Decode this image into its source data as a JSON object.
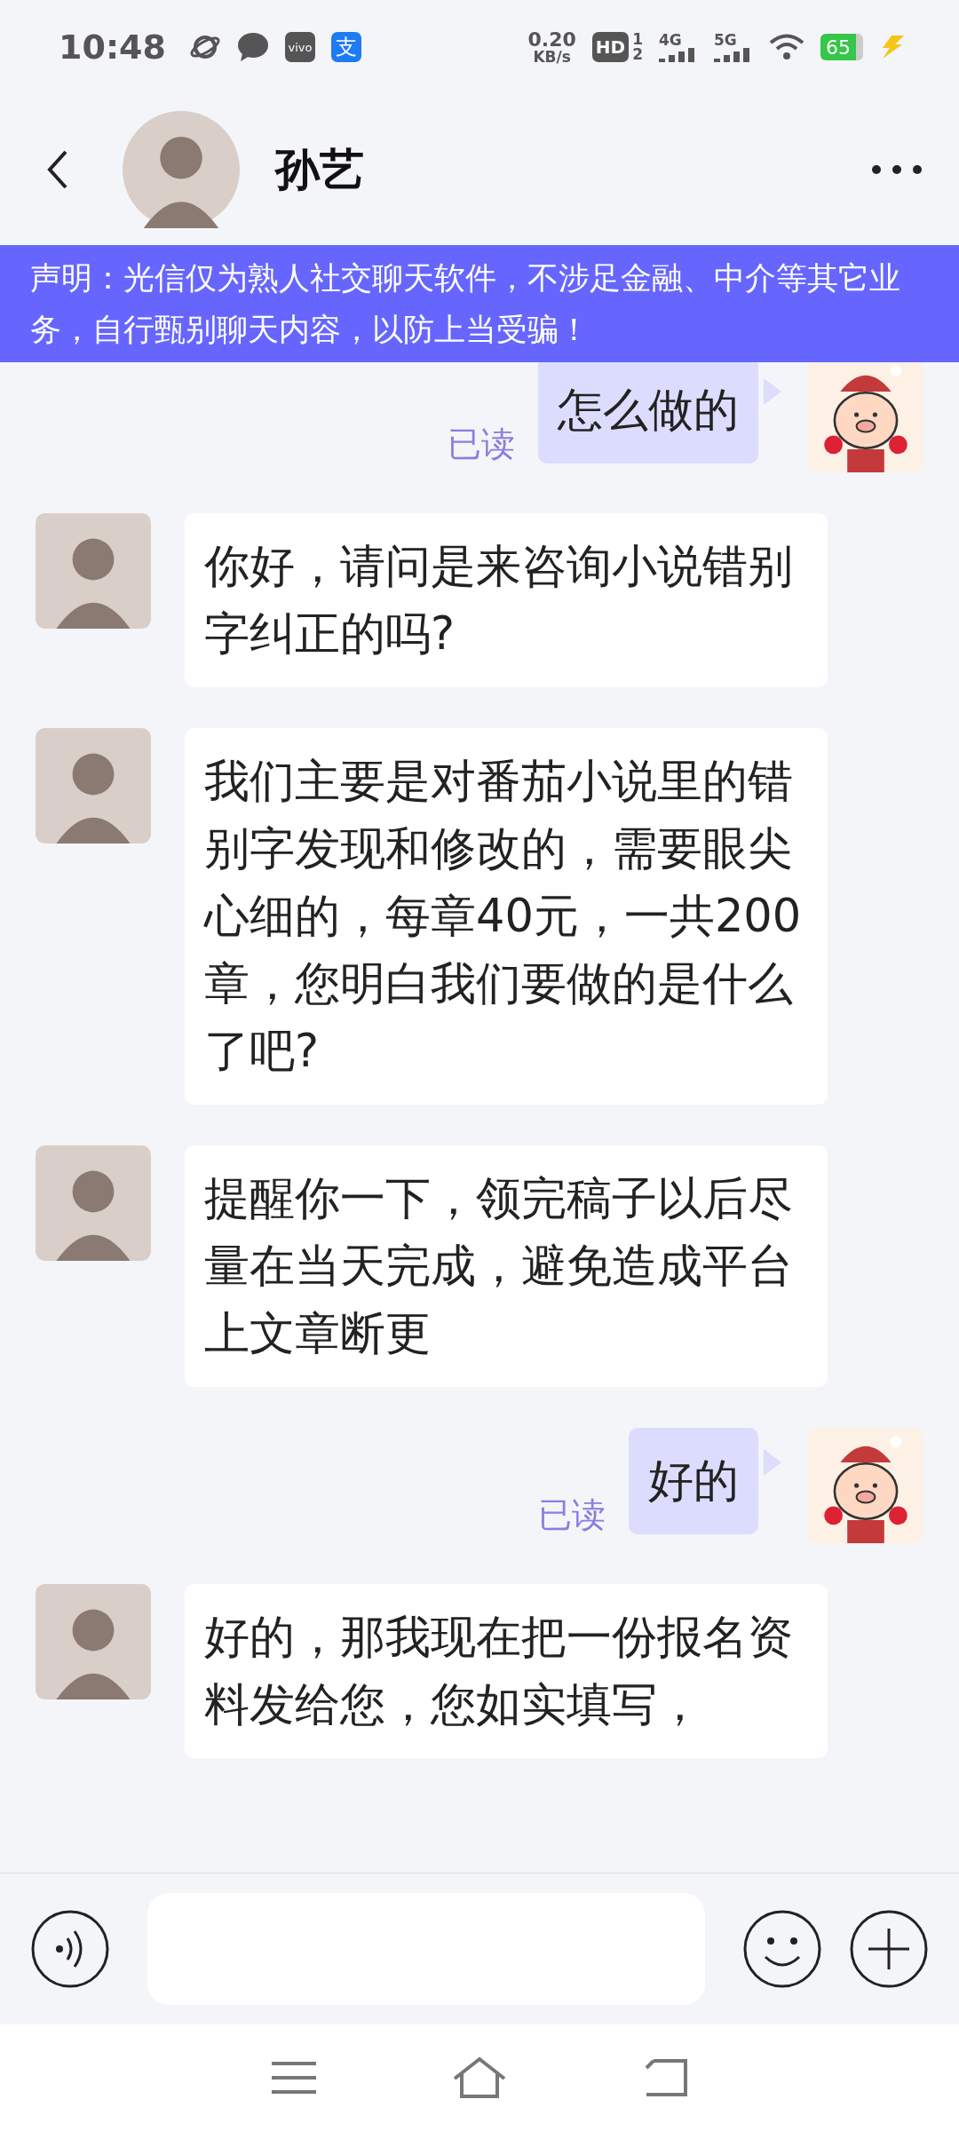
{
  "status_bar": {
    "time": "10:48",
    "app_badge": "vivo",
    "pay_badge": "支",
    "net_speed": "0.20",
    "net_unit": "KB/s",
    "hd": "HD",
    "sim1": "1",
    "sim2": "2",
    "net1": "4G",
    "net2": "5G",
    "battery": "65"
  },
  "header": {
    "title": "孙艺"
  },
  "notice": "声明：光信仅为熟人社交聊天软件，不涉足金融、中介等其它业务，自行甄别聊天内容，以防上当受骗！",
  "messages": [
    {
      "kind": "sent",
      "text": "怎么做的",
      "status": "已读"
    },
    {
      "kind": "received",
      "text": "你好，请问是来咨询小说错别字纠正的吗?"
    },
    {
      "kind": "received",
      "text": "我们主要是对番茄小说里的错别字发现和修改的，需要眼尖心细的，每章40元，一共200章，您明白我们要做的是什么了吧?"
    },
    {
      "kind": "received",
      "text": "提醒你一下，领完稿子以后尽量在当天完成，避免造成平台上文章断更"
    },
    {
      "kind": "sent",
      "text": "好的",
      "status": "已读"
    },
    {
      "kind": "received",
      "text": "好的，那我现在把一份报名资料发给您，您如实填写，"
    }
  ]
}
